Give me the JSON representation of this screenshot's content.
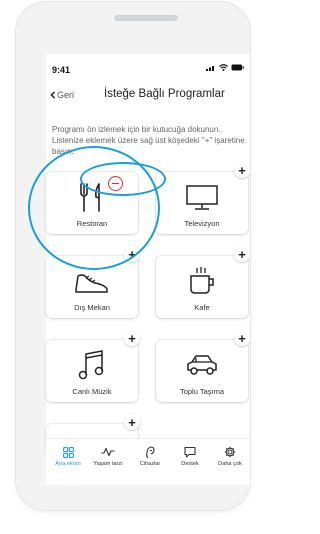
{
  "status_bar": {
    "time": "9:41"
  },
  "nav": {
    "back_label": "Geri",
    "title": "İsteğe Bağlı Programlar"
  },
  "description": "Programı ön izlemek için bir kutucuğa dokunun. Listenize eklemek üzere sağ üst köşedeki \"+\" işaretine basın.",
  "programs": [
    {
      "label": "Restoran",
      "icon": "restaurant-icon",
      "action": "remove"
    },
    {
      "label": "Televizyon",
      "icon": "tv-icon",
      "action": "add"
    },
    {
      "label": "Dış Mekan",
      "icon": "shoe-icon",
      "action": "add"
    },
    {
      "label": "Kafe",
      "icon": "coffee-icon",
      "action": "add"
    },
    {
      "label": "Canlı Müzik",
      "icon": "music-note-icon",
      "action": "add"
    },
    {
      "label": "Toplu Taşıma",
      "icon": "car-icon",
      "action": "add"
    }
  ],
  "plus_symbol": "+",
  "tabs": [
    {
      "label": "Ana ekran",
      "icon": "home-grid-icon",
      "active": true
    },
    {
      "label": "Yaşam tarzı",
      "icon": "activity-icon",
      "active": false
    },
    {
      "label": "Cihazlar",
      "icon": "hearing-aid-icon",
      "active": false
    },
    {
      "label": "Destek",
      "icon": "chat-icon",
      "active": false
    },
    {
      "label": "Daha çok",
      "icon": "gear-icon",
      "active": false
    }
  ],
  "colors": {
    "accent": "#1a9fd6",
    "remove": "#d9342b"
  }
}
